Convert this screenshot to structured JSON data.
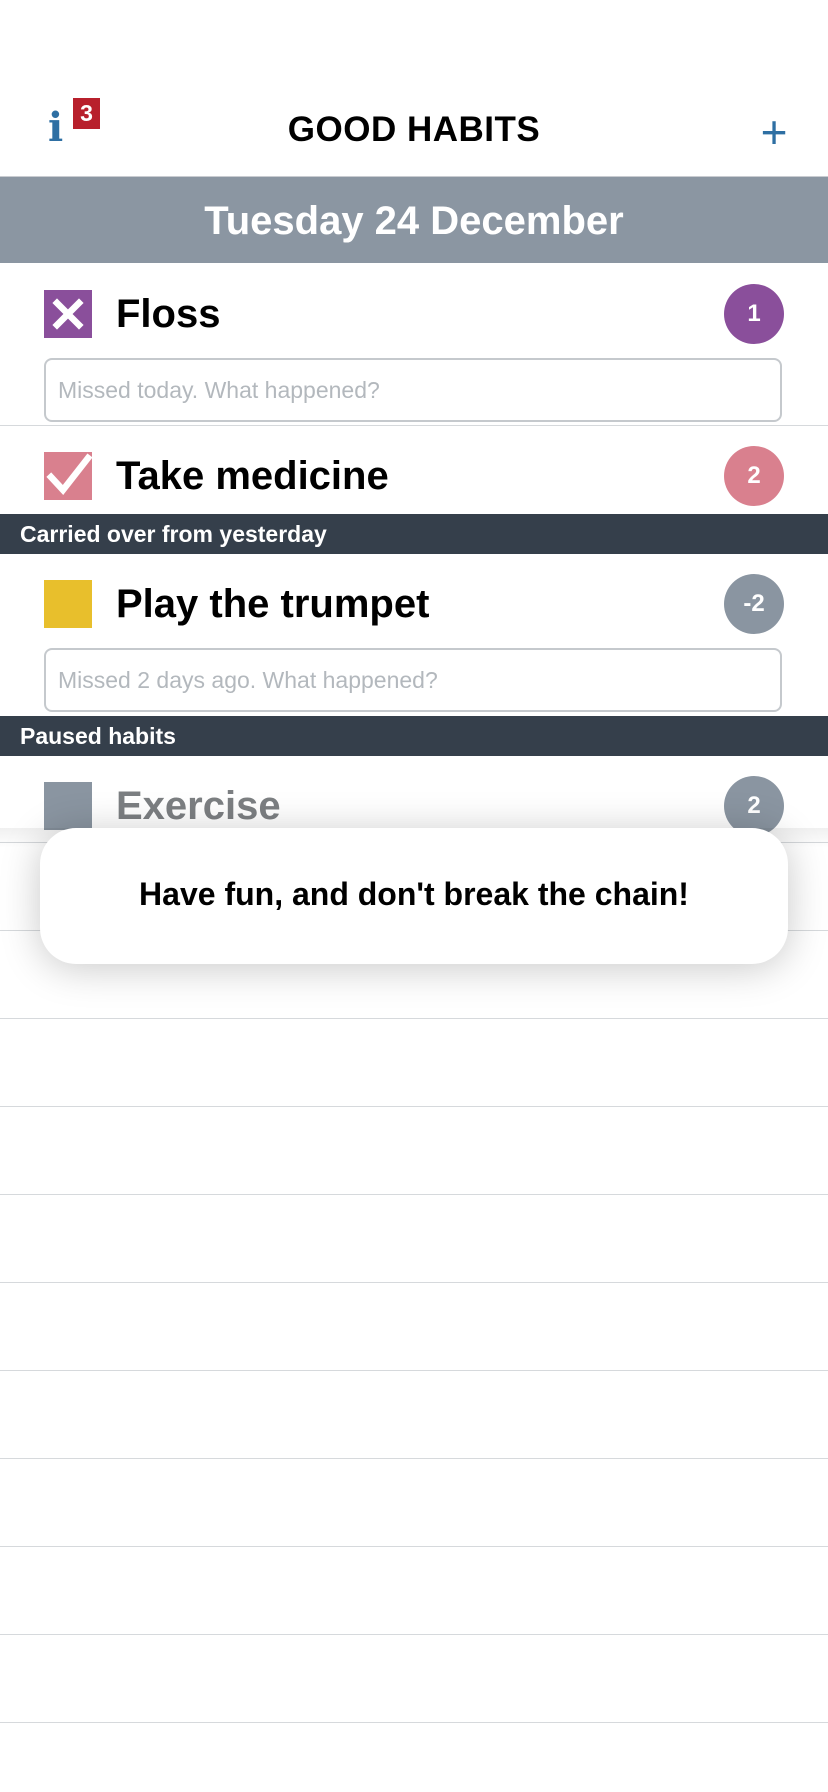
{
  "header": {
    "title": "GOOD HABITS",
    "info_icon": "i",
    "info_badge": "3",
    "add_icon": "+"
  },
  "date_bar": {
    "label": "Tuesday 24 December"
  },
  "sections": {
    "carried_over": "Carried over from yesterday",
    "paused": "Paused habits"
  },
  "habits": [
    {
      "name": "Floss",
      "status": "missed",
      "count": "1",
      "color": "#8a4f9b",
      "note_placeholder": "Missed today. What happened?"
    },
    {
      "name": "Take medicine",
      "status": "done",
      "count": "2",
      "color": "#d9808e"
    },
    {
      "name": "Play the trumpet",
      "status": "pending",
      "count": "-2",
      "color": "#e8bf2c",
      "count_color": "#8a95a1",
      "note_placeholder": "Missed 2 days ago. What happened?"
    },
    {
      "name": "Exercise",
      "status": "paused",
      "count": "2",
      "color": "#8a95a1"
    }
  ],
  "toast": {
    "message": "Have fun, and don't break the chain!"
  },
  "icons": [
    "info-icon",
    "add-icon",
    "x-checkbox-icon",
    "checkmark-checkbox-icon"
  ]
}
